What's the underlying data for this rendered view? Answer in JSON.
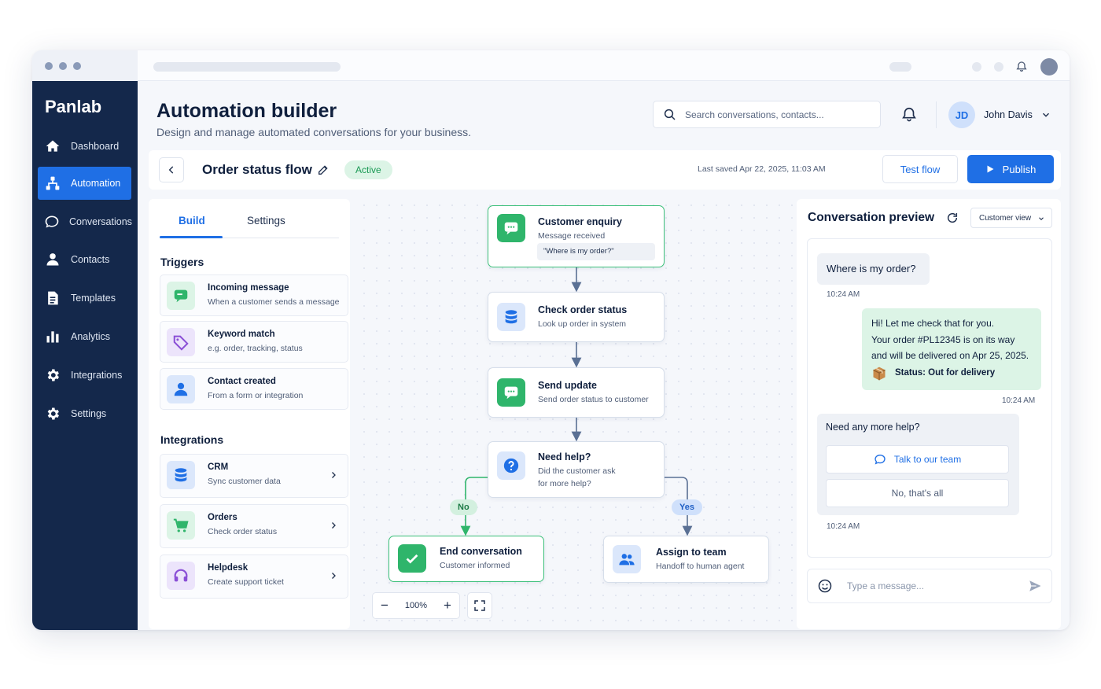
{
  "app": {
    "brand": "Panlab"
  },
  "colors": {
    "sidebar": "#14284b",
    "accent": "#1f6fe5",
    "success": "#2fb56b",
    "success_bg": "#dcf4e6"
  },
  "nav": [
    {
      "label": "Dashboard",
      "icon": "home-icon",
      "active": false
    },
    {
      "label": "Automation",
      "icon": "flow-icon",
      "active": true
    },
    {
      "label": "Conversations",
      "icon": "chat-bubble-icon",
      "active": false
    },
    {
      "label": "Contacts",
      "icon": "user-icon",
      "active": false
    },
    {
      "label": "Templates",
      "icon": "document-icon",
      "active": false
    },
    {
      "label": "Analytics",
      "icon": "bar-chart-icon",
      "active": false
    },
    {
      "label": "Integrations",
      "icon": "gear-icon",
      "active": false
    },
    {
      "label": "Settings",
      "icon": "gear-icon",
      "active": false
    }
  ],
  "header": {
    "title": "Automation builder",
    "subtitle": "Design and manage automated conversations for your business.",
    "search_placeholder": "Search conversations, contacts...",
    "user": {
      "initials": "JD",
      "name": "John Davis"
    }
  },
  "toolbar": {
    "flow_name": "Order status flow",
    "status": "Active",
    "last_saved": "Last saved Apr 22, 2025, 11:03 AM",
    "test_label": "Test flow",
    "publish_label": "Publish"
  },
  "builder": {
    "tabs": [
      "Build",
      "Settings"
    ],
    "triggers_heading": "Triggers",
    "triggers": [
      {
        "title": "Incoming message",
        "sub": "When a customer sends a message",
        "icon": "message-icon"
      },
      {
        "title": "Keyword match",
        "sub": "e.g. order, tracking, status",
        "icon": "tag-icon"
      },
      {
        "title": "Contact created",
        "sub": "From a form or integration",
        "icon": "user-icon"
      }
    ],
    "integrations_heading": "Integrations",
    "integrations": [
      {
        "title": "CRM",
        "sub": "Sync customer data",
        "icon": "database-icon"
      },
      {
        "title": "Orders",
        "sub": "Check order status",
        "icon": "cart-icon"
      },
      {
        "title": "Helpdesk",
        "sub": "Create support ticket",
        "icon": "headset-icon"
      }
    ]
  },
  "flow": {
    "nodes": {
      "enquiry": {
        "title": "Customer enquiry",
        "sub": "Message received",
        "quote": "\"Where is my order?\""
      },
      "check": {
        "title": "Check order status",
        "sub": "Look up order in system"
      },
      "update": {
        "title": "Send update",
        "sub": "Send order status to customer"
      },
      "help": {
        "title": "Need help?",
        "sub1": "Did the customer ask",
        "sub2": "for more help?"
      },
      "end": {
        "title": "End conversation",
        "sub": "Customer informed"
      },
      "assign": {
        "title": "Assign to team",
        "sub": "Handoff to human agent"
      }
    },
    "branch_no": "No",
    "branch_yes": "Yes",
    "zoom": "100%"
  },
  "preview": {
    "title": "Conversation preview",
    "view": "Customer view",
    "messages": {
      "q1": "Where is my order?",
      "t1": "10:24 AM",
      "reply1": "Hi! Let me check that for you.",
      "reply2": "Your order #PL12345 is on its way",
      "reply3": "and will be delivered on Apr 25, 2025.",
      "status": "Status: Out for delivery",
      "t2": "10:24 AM",
      "q2": "Need any more help?",
      "opt1": "Talk to our team",
      "opt2": "No, that's all",
      "t3": "10:24 AM"
    },
    "composer_placeholder": "Type a message..."
  }
}
